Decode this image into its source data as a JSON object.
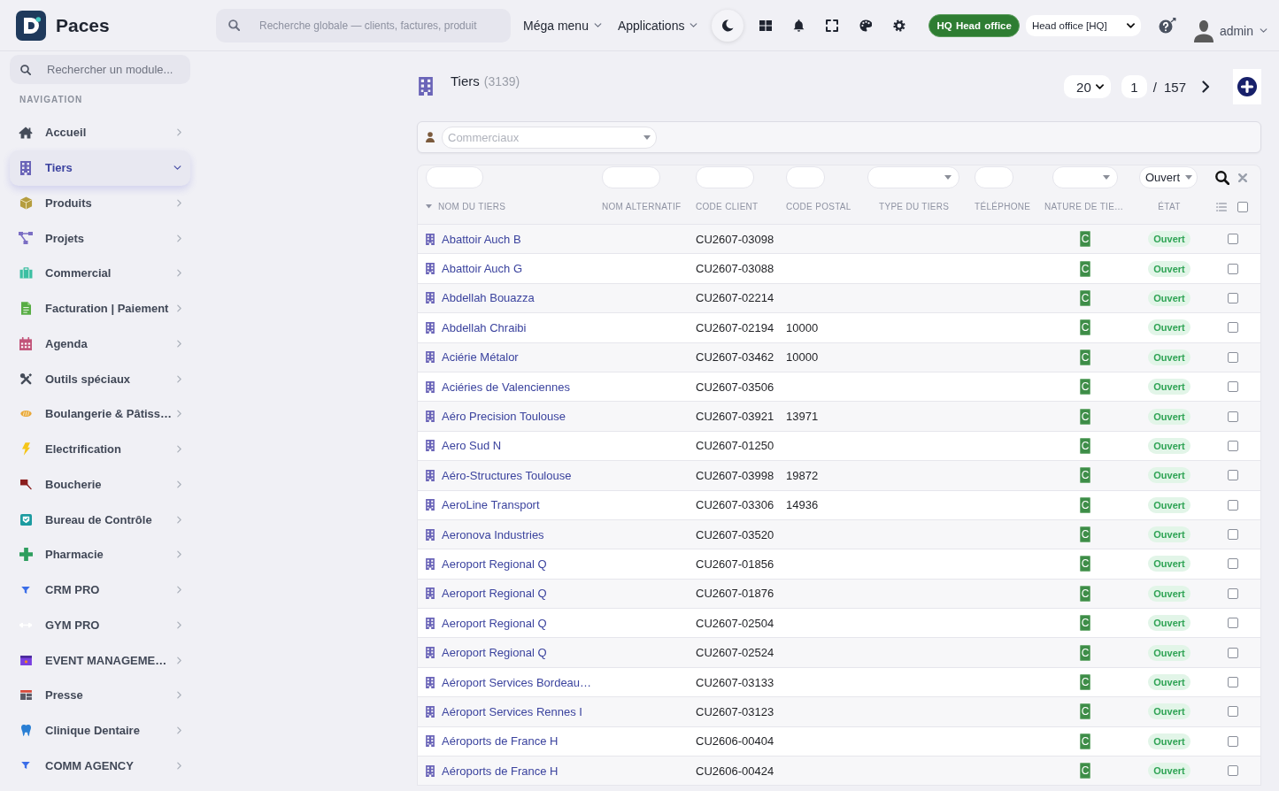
{
  "topbar": {
    "brand": "Paces",
    "search": {
      "placeholder": "Recherche globale — clients, factures, produit"
    },
    "menus": [
      {
        "label": "Méga menu"
      },
      {
        "label": "Applications"
      }
    ],
    "office_badge": "HQ Head office",
    "office_select": {
      "value": "Head office [HQ]"
    },
    "user": {
      "name": "admin"
    }
  },
  "sidebar": {
    "search": {
      "placeholder": "Rechercher un module..."
    },
    "section_title": "NAVIGATION",
    "items": [
      {
        "label": "Accueil",
        "selected": false,
        "expanded": false
      },
      {
        "label": "Tiers",
        "selected": true,
        "expanded": true
      },
      {
        "label": "Produits",
        "selected": false,
        "expanded": false
      },
      {
        "label": "Projets",
        "selected": false,
        "expanded": false
      },
      {
        "label": "Commercial",
        "selected": false,
        "expanded": false
      },
      {
        "label": "Facturation | Paiement",
        "selected": false,
        "expanded": false
      },
      {
        "label": "Agenda",
        "selected": false,
        "expanded": false
      },
      {
        "label": "Outils spéciaux",
        "selected": false,
        "expanded": false
      },
      {
        "label": "Boulangerie & Pâtiss…",
        "selected": false,
        "expanded": false
      },
      {
        "label": "Electrification",
        "selected": false,
        "expanded": false
      },
      {
        "label": "Boucherie",
        "selected": false,
        "expanded": false
      },
      {
        "label": "Bureau de Contrôle",
        "selected": false,
        "expanded": false
      },
      {
        "label": "Pharmacie",
        "selected": false,
        "expanded": false
      },
      {
        "label": "CRM PRO",
        "selected": false,
        "expanded": false
      },
      {
        "label": "GYM PRO",
        "selected": false,
        "expanded": false
      },
      {
        "label": "EVENT MANAGEME…",
        "selected": false,
        "expanded": false
      },
      {
        "label": "Presse",
        "selected": false,
        "expanded": false
      },
      {
        "label": "Clinique Dentaire",
        "selected": false,
        "expanded": false
      },
      {
        "label": "COMM AGENCY",
        "selected": false,
        "expanded": false
      }
    ]
  },
  "page": {
    "title": "Tiers",
    "count": "(3139)",
    "page_size": "20",
    "page_number": "1",
    "separator": "/",
    "total_pages": "157"
  },
  "filter_bar": {
    "salesperson_select": {
      "placeholder": "Commerciaux"
    }
  },
  "table": {
    "filters": [
      {
        "kind": "text"
      },
      {
        "kind": "text"
      },
      {
        "kind": "text"
      },
      {
        "kind": "text"
      },
      {
        "kind": "select"
      },
      {
        "kind": "text"
      },
      {
        "kind": "select"
      },
      {
        "kind": "select",
        "value": "Ouvert"
      }
    ],
    "columns": [
      {
        "label": "NOM DU TIERS",
        "sorted": true
      },
      {
        "label": "NOM ALTERNATIF",
        "sorted": false
      },
      {
        "label": "CODE CLIENT",
        "sorted": false
      },
      {
        "label": "CODE POSTAL",
        "sorted": false
      },
      {
        "label": "TYPE DU TIERS",
        "sorted": false
      },
      {
        "label": "TÉLÉPHONE",
        "sorted": false
      },
      {
        "label": "NATURE DE TIE…",
        "sorted": false
      },
      {
        "label": "ÉTAT",
        "sorted": false
      }
    ],
    "select_all": {
      "checked": false
    },
    "rows": [
      {
        "name": "Abattoir Auch B",
        "code_client": "CU2607-03098",
        "nature": "C",
        "status": "Ouvert",
        "checked": false
      },
      {
        "name": "Abattoir Auch G",
        "code_client": "CU2607-03088",
        "nature": "C",
        "status": "Ouvert",
        "checked": false
      },
      {
        "name": "Abdellah Bouazza",
        "code_client": "CU2607-02214",
        "nature": "C",
        "status": "Ouvert",
        "checked": false
      },
      {
        "name": "Abdellah Chraibi",
        "code_client": "CU2607-02194",
        "postal_code": "10000",
        "nature": "C",
        "status": "Ouvert",
        "checked": false
      },
      {
        "name": "Aciérie Métalor",
        "code_client": "CU2607-03462",
        "postal_code": "10000",
        "nature": "C",
        "status": "Ouvert",
        "checked": false
      },
      {
        "name": "Aciéries de Valenciennes",
        "code_client": "CU2607-03506",
        "nature": "C",
        "status": "Ouvert",
        "checked": false
      },
      {
        "name": "Aéro Precision Toulouse",
        "code_client": "CU2607-03921",
        "postal_code": "13971",
        "nature": "C",
        "status": "Ouvert",
        "checked": false
      },
      {
        "name": "Aero Sud N",
        "code_client": "CU2607-01250",
        "nature": "C",
        "status": "Ouvert",
        "checked": false
      },
      {
        "name": "Aéro-Structures Toulouse",
        "code_client": "CU2607-03998",
        "postal_code": "19872",
        "nature": "C",
        "status": "Ouvert",
        "checked": false
      },
      {
        "name": "AeroLine Transport",
        "code_client": "CU2607-03306",
        "postal_code": "14936",
        "nature": "C",
        "status": "Ouvert",
        "checked": false
      },
      {
        "name": "Aeronova Industries",
        "code_client": "CU2607-03520",
        "nature": "C",
        "status": "Ouvert",
        "checked": false
      },
      {
        "name": "Aeroport Regional Q",
        "code_client": "CU2607-01856",
        "nature": "C",
        "status": "Ouvert",
        "checked": false
      },
      {
        "name": "Aeroport Regional Q",
        "code_client": "CU2607-01876",
        "nature": "C",
        "status": "Ouvert",
        "checked": false
      },
      {
        "name": "Aeroport Regional Q",
        "code_client": "CU2607-02504",
        "nature": "C",
        "status": "Ouvert",
        "checked": false
      },
      {
        "name": "Aeroport Regional Q",
        "code_client": "CU2607-02524",
        "nature": "C",
        "status": "Ouvert",
        "checked": false
      },
      {
        "name": "Aéroport Services Bordeau…",
        "code_client": "CU2607-03133",
        "nature": "C",
        "status": "Ouvert",
        "checked": false
      },
      {
        "name": "Aéroport Services Rennes I",
        "code_client": "CU2607-03123",
        "nature": "C",
        "status": "Ouvert",
        "checked": false
      },
      {
        "name": "Aéroports de France H",
        "code_client": "CU2606-00404",
        "nature": "C",
        "status": "Ouvert",
        "checked": false
      },
      {
        "name": "Aéroports de France H",
        "code_client": "CU2606-00424",
        "nature": "C",
        "status": "Ouvert",
        "checked": false
      }
    ]
  }
}
